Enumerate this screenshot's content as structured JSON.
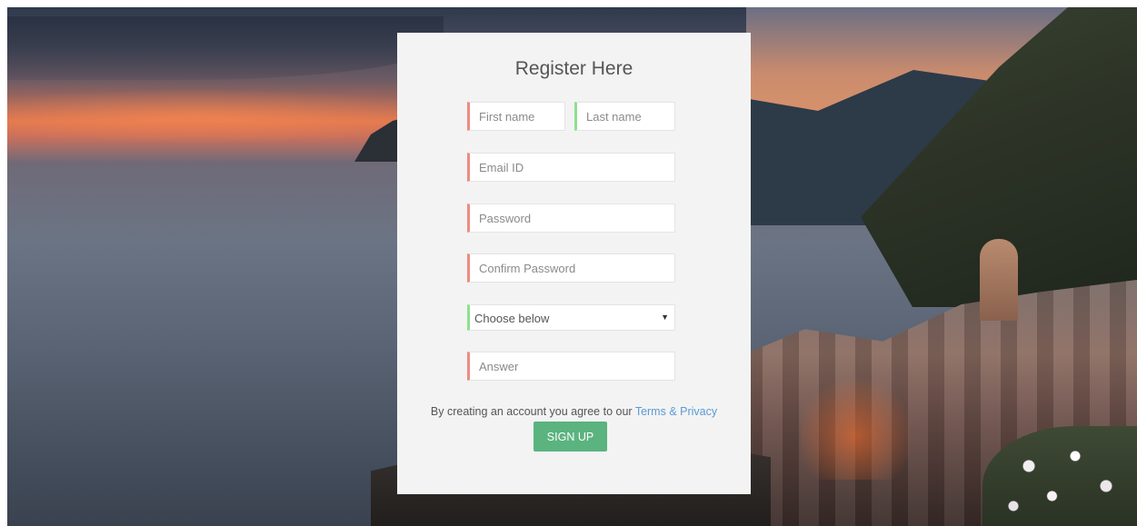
{
  "form": {
    "title": "Register Here",
    "first_name_placeholder": "First name",
    "last_name_placeholder": "Last name",
    "email_placeholder": "Email ID",
    "password_placeholder": "Password",
    "confirm_password_placeholder": "Confirm Password",
    "question_select_value": "Choose below",
    "answer_placeholder": "Answer",
    "terms_prefix": "By creating an account you agree to our ",
    "terms_link": "Terms & Privacy",
    "signup_label": "SIGN UP"
  },
  "colors": {
    "card_background": "#f3f3f3",
    "field_accent_red": "#ee8c80",
    "field_accent_green": "#8ee08e",
    "link": "#5b9bd5",
    "signup_button": "#5bb37f"
  },
  "icons": {
    "select_arrow": "dropdown-arrow-icon"
  }
}
